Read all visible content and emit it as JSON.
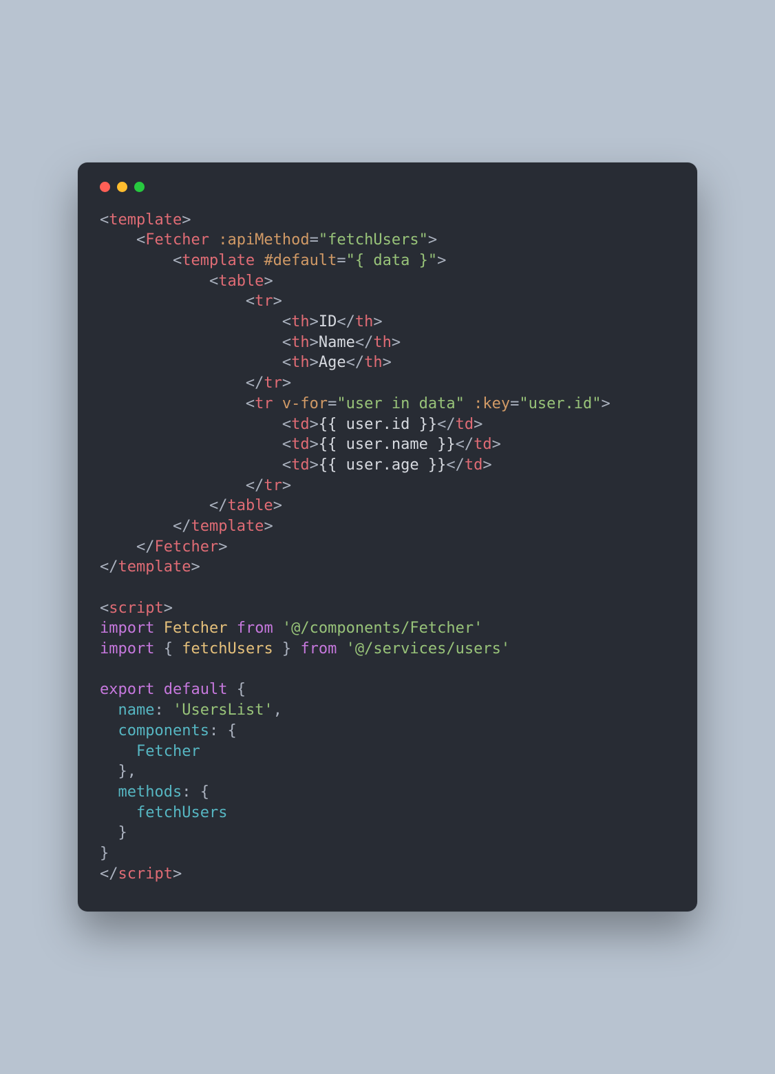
{
  "window": {
    "dot_colors": [
      "#ff5f56",
      "#ffbd2e",
      "#27c93f"
    ]
  },
  "code": {
    "tokens": [
      {
        "t": "<",
        "c": "gray"
      },
      {
        "t": "template",
        "c": "red"
      },
      {
        "t": ">",
        "c": "gray"
      },
      {
        "t": "\n",
        "c": "gray"
      },
      {
        "t": "    ",
        "c": "gray"
      },
      {
        "t": "<",
        "c": "gray"
      },
      {
        "t": "Fetcher",
        "c": "red"
      },
      {
        "t": " ",
        "c": "gray"
      },
      {
        "t": ":apiMethod",
        "c": "orange"
      },
      {
        "t": "=",
        "c": "gray"
      },
      {
        "t": "\"fetchUsers\"",
        "c": "green"
      },
      {
        "t": ">",
        "c": "gray"
      },
      {
        "t": "\n",
        "c": "gray"
      },
      {
        "t": "        ",
        "c": "gray"
      },
      {
        "t": "<",
        "c": "gray"
      },
      {
        "t": "template",
        "c": "red"
      },
      {
        "t": " ",
        "c": "gray"
      },
      {
        "t": "#default",
        "c": "orange"
      },
      {
        "t": "=",
        "c": "gray"
      },
      {
        "t": "\"{ data }\"",
        "c": "green"
      },
      {
        "t": ">",
        "c": "gray"
      },
      {
        "t": "\n",
        "c": "gray"
      },
      {
        "t": "            ",
        "c": "gray"
      },
      {
        "t": "<",
        "c": "gray"
      },
      {
        "t": "table",
        "c": "red"
      },
      {
        "t": ">",
        "c": "gray"
      },
      {
        "t": "\n",
        "c": "gray"
      },
      {
        "t": "                ",
        "c": "gray"
      },
      {
        "t": "<",
        "c": "gray"
      },
      {
        "t": "tr",
        "c": "red"
      },
      {
        "t": ">",
        "c": "gray"
      },
      {
        "t": "\n",
        "c": "gray"
      },
      {
        "t": "                    ",
        "c": "gray"
      },
      {
        "t": "<",
        "c": "gray"
      },
      {
        "t": "th",
        "c": "red"
      },
      {
        "t": ">",
        "c": "gray"
      },
      {
        "t": "ID",
        "c": "white"
      },
      {
        "t": "</",
        "c": "gray"
      },
      {
        "t": "th",
        "c": "red"
      },
      {
        "t": ">",
        "c": "gray"
      },
      {
        "t": "\n",
        "c": "gray"
      },
      {
        "t": "                    ",
        "c": "gray"
      },
      {
        "t": "<",
        "c": "gray"
      },
      {
        "t": "th",
        "c": "red"
      },
      {
        "t": ">",
        "c": "gray"
      },
      {
        "t": "Name",
        "c": "white"
      },
      {
        "t": "</",
        "c": "gray"
      },
      {
        "t": "th",
        "c": "red"
      },
      {
        "t": ">",
        "c": "gray"
      },
      {
        "t": "\n",
        "c": "gray"
      },
      {
        "t": "                    ",
        "c": "gray"
      },
      {
        "t": "<",
        "c": "gray"
      },
      {
        "t": "th",
        "c": "red"
      },
      {
        "t": ">",
        "c": "gray"
      },
      {
        "t": "Age",
        "c": "white"
      },
      {
        "t": "</",
        "c": "gray"
      },
      {
        "t": "th",
        "c": "red"
      },
      {
        "t": ">",
        "c": "gray"
      },
      {
        "t": "\n",
        "c": "gray"
      },
      {
        "t": "                ",
        "c": "gray"
      },
      {
        "t": "</",
        "c": "gray"
      },
      {
        "t": "tr",
        "c": "red"
      },
      {
        "t": ">",
        "c": "gray"
      },
      {
        "t": "\n",
        "c": "gray"
      },
      {
        "t": "                ",
        "c": "gray"
      },
      {
        "t": "<",
        "c": "gray"
      },
      {
        "t": "tr",
        "c": "red"
      },
      {
        "t": " ",
        "c": "gray"
      },
      {
        "t": "v-for",
        "c": "orange"
      },
      {
        "t": "=",
        "c": "gray"
      },
      {
        "t": "\"user in data\"",
        "c": "green"
      },
      {
        "t": " ",
        "c": "gray"
      },
      {
        "t": ":key",
        "c": "orange"
      },
      {
        "t": "=",
        "c": "gray"
      },
      {
        "t": "\"user.id\"",
        "c": "green"
      },
      {
        "t": ">",
        "c": "gray"
      },
      {
        "t": "\n",
        "c": "gray"
      },
      {
        "t": "                    ",
        "c": "gray"
      },
      {
        "t": "<",
        "c": "gray"
      },
      {
        "t": "td",
        "c": "red"
      },
      {
        "t": ">",
        "c": "gray"
      },
      {
        "t": "{{ user.id }}",
        "c": "white"
      },
      {
        "t": "</",
        "c": "gray"
      },
      {
        "t": "td",
        "c": "red"
      },
      {
        "t": ">",
        "c": "gray"
      },
      {
        "t": "\n",
        "c": "gray"
      },
      {
        "t": "                    ",
        "c": "gray"
      },
      {
        "t": "<",
        "c": "gray"
      },
      {
        "t": "td",
        "c": "red"
      },
      {
        "t": ">",
        "c": "gray"
      },
      {
        "t": "{{ user.name }}",
        "c": "white"
      },
      {
        "t": "</",
        "c": "gray"
      },
      {
        "t": "td",
        "c": "red"
      },
      {
        "t": ">",
        "c": "gray"
      },
      {
        "t": "\n",
        "c": "gray"
      },
      {
        "t": "                    ",
        "c": "gray"
      },
      {
        "t": "<",
        "c": "gray"
      },
      {
        "t": "td",
        "c": "red"
      },
      {
        "t": ">",
        "c": "gray"
      },
      {
        "t": "{{ user.age }}",
        "c": "white"
      },
      {
        "t": "</",
        "c": "gray"
      },
      {
        "t": "td",
        "c": "red"
      },
      {
        "t": ">",
        "c": "gray"
      },
      {
        "t": "\n",
        "c": "gray"
      },
      {
        "t": "                ",
        "c": "gray"
      },
      {
        "t": "</",
        "c": "gray"
      },
      {
        "t": "tr",
        "c": "red"
      },
      {
        "t": ">",
        "c": "gray"
      },
      {
        "t": "\n",
        "c": "gray"
      },
      {
        "t": "            ",
        "c": "gray"
      },
      {
        "t": "</",
        "c": "gray"
      },
      {
        "t": "table",
        "c": "red"
      },
      {
        "t": ">",
        "c": "gray"
      },
      {
        "t": "\n",
        "c": "gray"
      },
      {
        "t": "        ",
        "c": "gray"
      },
      {
        "t": "</",
        "c": "gray"
      },
      {
        "t": "template",
        "c": "red"
      },
      {
        "t": ">",
        "c": "gray"
      },
      {
        "t": "\n",
        "c": "gray"
      },
      {
        "t": "    ",
        "c": "gray"
      },
      {
        "t": "</",
        "c": "gray"
      },
      {
        "t": "Fetcher",
        "c": "red"
      },
      {
        "t": ">",
        "c": "gray"
      },
      {
        "t": "\n",
        "c": "gray"
      },
      {
        "t": "</",
        "c": "gray"
      },
      {
        "t": "template",
        "c": "red"
      },
      {
        "t": ">",
        "c": "gray"
      },
      {
        "t": "\n",
        "c": "gray"
      },
      {
        "t": "\n",
        "c": "gray"
      },
      {
        "t": "<",
        "c": "gray"
      },
      {
        "t": "script",
        "c": "red"
      },
      {
        "t": ">",
        "c": "gray"
      },
      {
        "t": "\n",
        "c": "gray"
      },
      {
        "t": "import",
        "c": "purple"
      },
      {
        "t": " ",
        "c": "gray"
      },
      {
        "t": "Fetcher",
        "c": "yellow"
      },
      {
        "t": " ",
        "c": "gray"
      },
      {
        "t": "from",
        "c": "purple"
      },
      {
        "t": " ",
        "c": "gray"
      },
      {
        "t": "'@/components/Fetcher'",
        "c": "green"
      },
      {
        "t": "\n",
        "c": "gray"
      },
      {
        "t": "import",
        "c": "purple"
      },
      {
        "t": " { ",
        "c": "gray"
      },
      {
        "t": "fetchUsers",
        "c": "yellow"
      },
      {
        "t": " } ",
        "c": "gray"
      },
      {
        "t": "from",
        "c": "purple"
      },
      {
        "t": " ",
        "c": "gray"
      },
      {
        "t": "'@/services/users'",
        "c": "green"
      },
      {
        "t": "\n",
        "c": "gray"
      },
      {
        "t": "\n",
        "c": "gray"
      },
      {
        "t": "export",
        "c": "purple"
      },
      {
        "t": " ",
        "c": "gray"
      },
      {
        "t": "default",
        "c": "purple"
      },
      {
        "t": " {",
        "c": "gray"
      },
      {
        "t": "\n",
        "c": "gray"
      },
      {
        "t": "  ",
        "c": "gray"
      },
      {
        "t": "name",
        "c": "cyan"
      },
      {
        "t": ": ",
        "c": "gray"
      },
      {
        "t": "'UsersList'",
        "c": "green"
      },
      {
        "t": ",",
        "c": "gray"
      },
      {
        "t": "\n",
        "c": "gray"
      },
      {
        "t": "  ",
        "c": "gray"
      },
      {
        "t": "components",
        "c": "cyan"
      },
      {
        "t": ": {",
        "c": "gray"
      },
      {
        "t": "\n",
        "c": "gray"
      },
      {
        "t": "    ",
        "c": "gray"
      },
      {
        "t": "Fetcher",
        "c": "cyan"
      },
      {
        "t": "\n",
        "c": "gray"
      },
      {
        "t": "  },",
        "c": "gray"
      },
      {
        "t": "\n",
        "c": "gray"
      },
      {
        "t": "  ",
        "c": "gray"
      },
      {
        "t": "methods",
        "c": "cyan"
      },
      {
        "t": ": {",
        "c": "gray"
      },
      {
        "t": "\n",
        "c": "gray"
      },
      {
        "t": "    ",
        "c": "gray"
      },
      {
        "t": "fetchUsers",
        "c": "cyan"
      },
      {
        "t": "\n",
        "c": "gray"
      },
      {
        "t": "  }",
        "c": "gray"
      },
      {
        "t": "\n",
        "c": "gray"
      },
      {
        "t": "}",
        "c": "gray"
      },
      {
        "t": "\n",
        "c": "gray"
      },
      {
        "t": "</",
        "c": "gray"
      },
      {
        "t": "script",
        "c": "red"
      },
      {
        "t": ">",
        "c": "gray"
      }
    ]
  }
}
